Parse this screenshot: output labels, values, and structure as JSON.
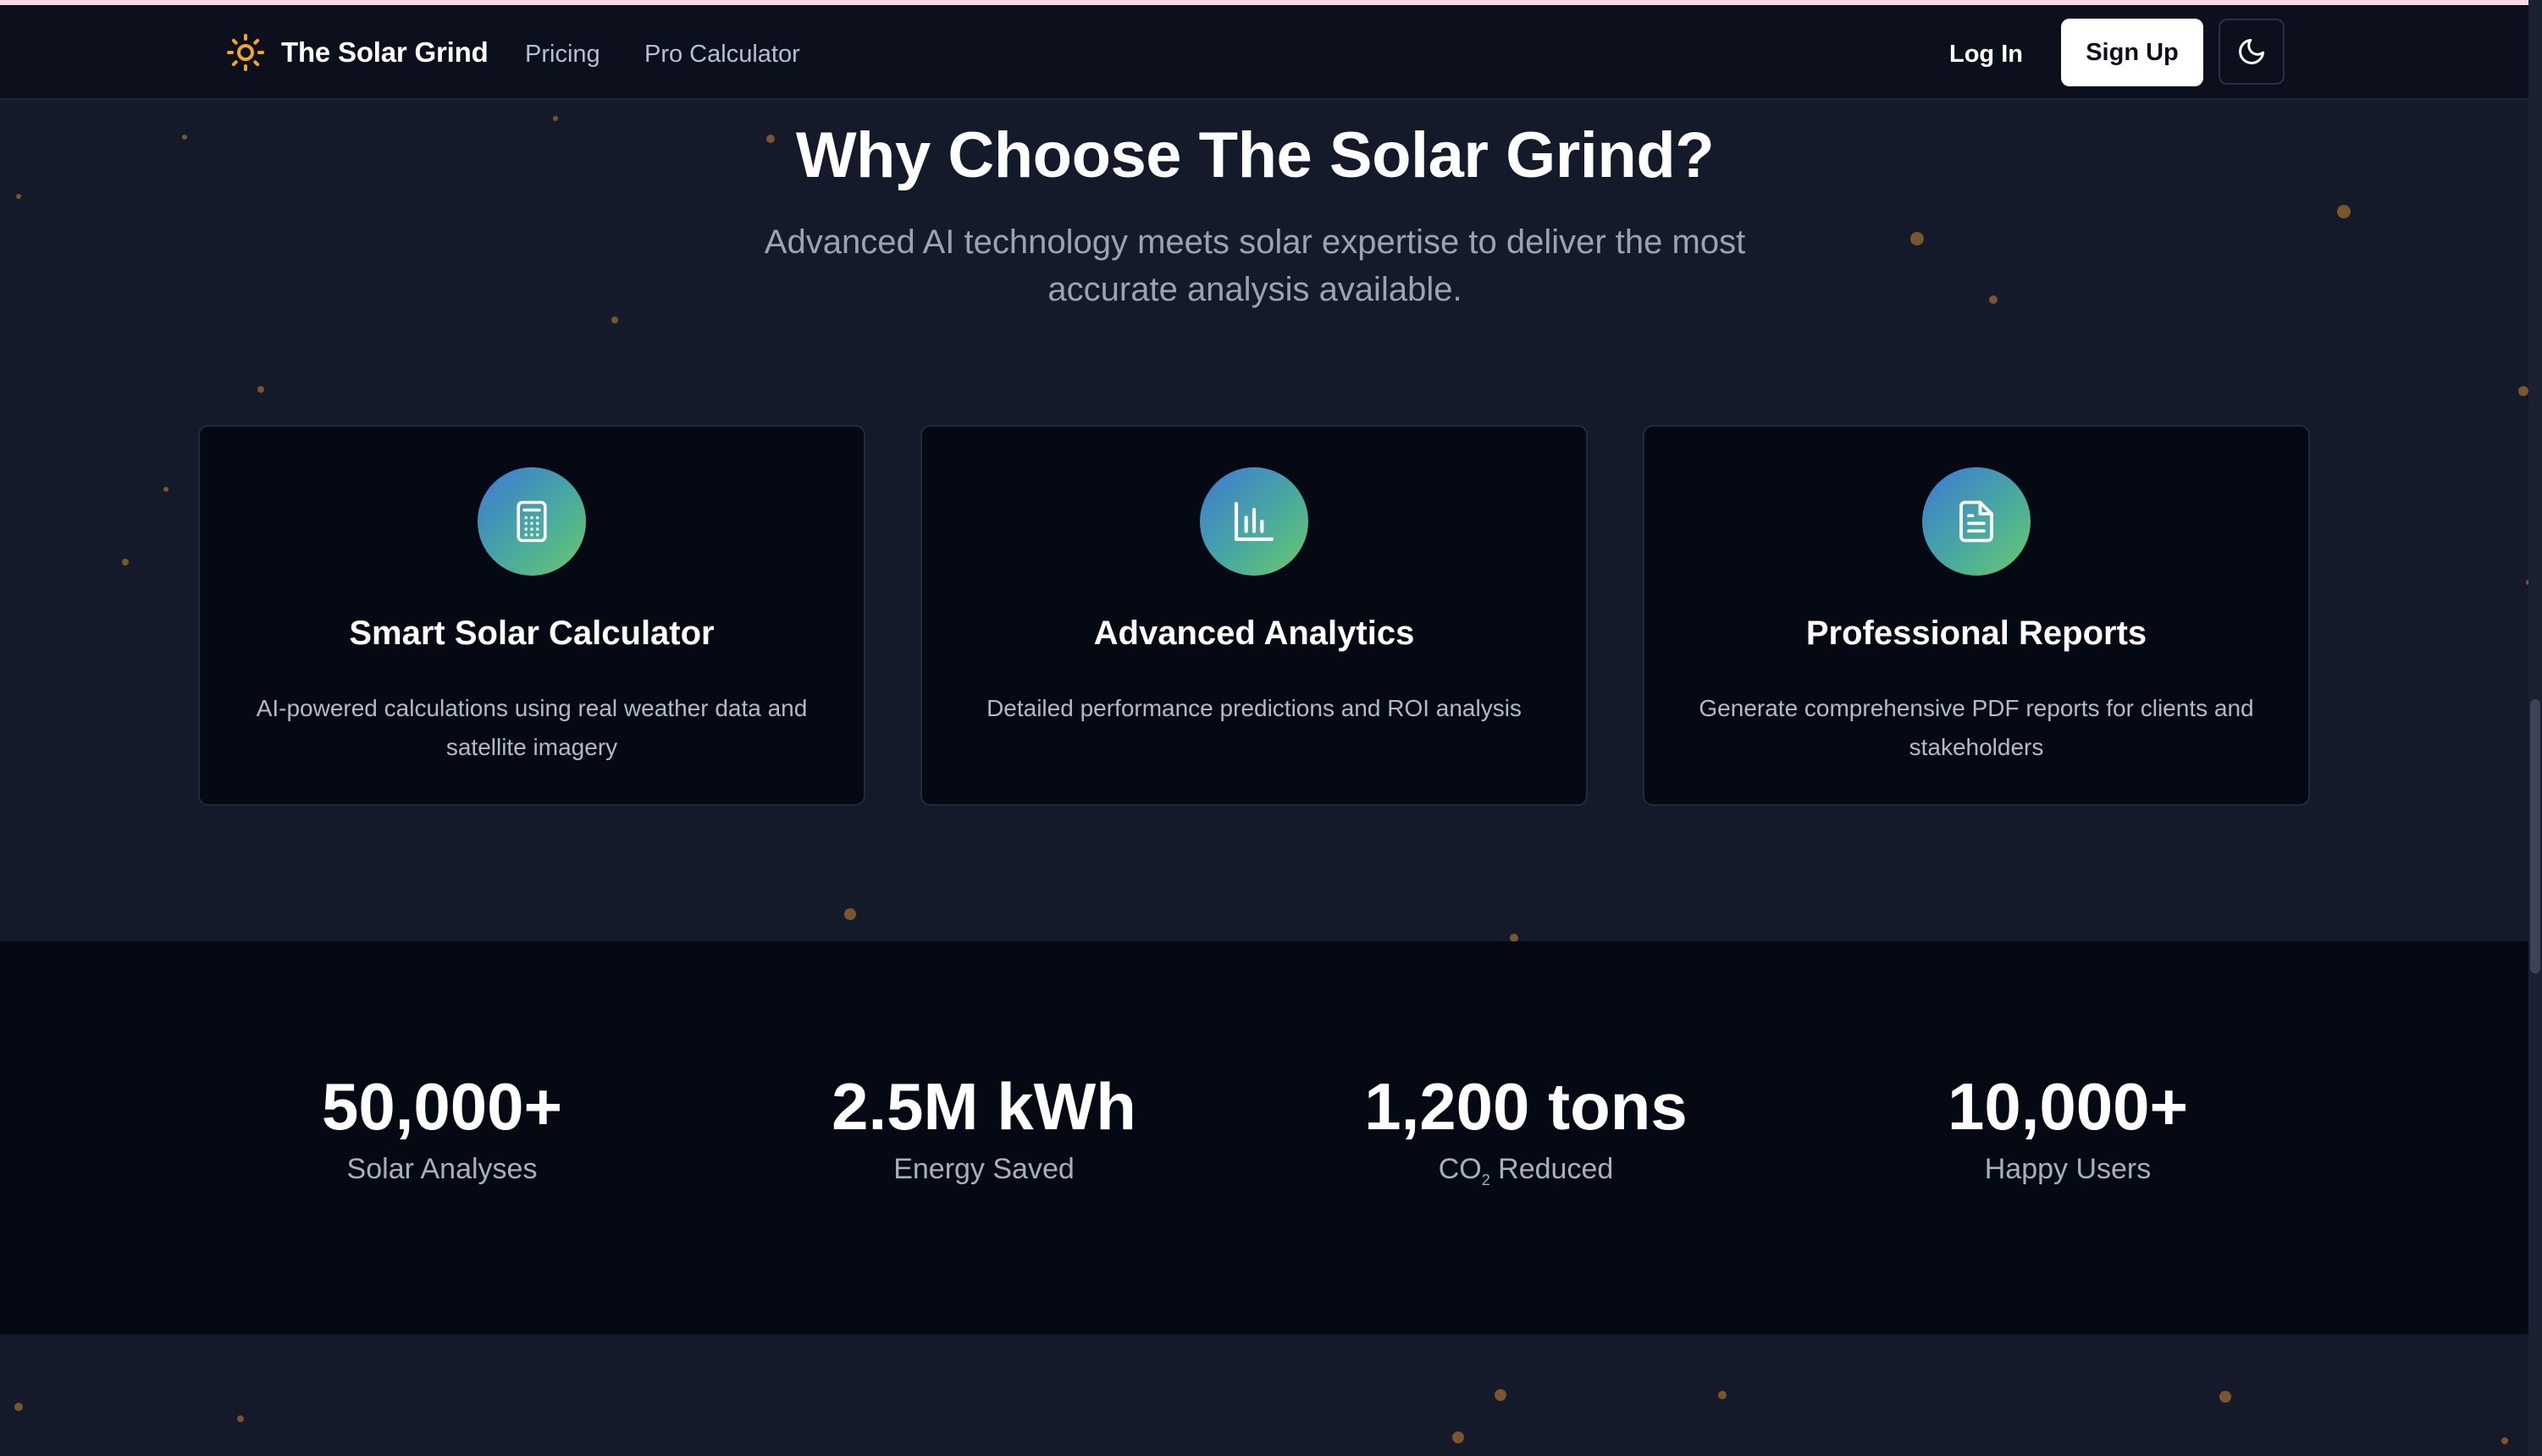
{
  "nav": {
    "brand": "The Solar Grind",
    "links": [
      "Pricing",
      "Pro Calculator"
    ],
    "login": "Log In",
    "signup": "Sign Up",
    "theme_icon": "moon-icon"
  },
  "features": {
    "title": "Why Choose The Solar Grind?",
    "subtitle": "Advanced AI technology meets solar expertise to deliver the most accurate analysis available.",
    "cards": [
      {
        "icon": "calculator-icon",
        "title": "Smart Solar Calculator",
        "description": "AI-powered calculations using real weather data and satellite imagery"
      },
      {
        "icon": "bar-chart-icon",
        "title": "Advanced Analytics",
        "description": "Detailed performance predictions and ROI analysis"
      },
      {
        "icon": "document-icon",
        "title": "Professional Reports",
        "description": "Generate comprehensive PDF reports for clients and stakeholders"
      }
    ]
  },
  "stats": [
    {
      "value": "50,000+",
      "label": "Solar Analyses"
    },
    {
      "value": "2.5M kWh",
      "label": "Energy Saved"
    },
    {
      "value": "1,200 tons",
      "label_prefix": "CO",
      "label_sub": "2",
      "label_suffix": " Reduced"
    },
    {
      "value": "10,000+",
      "label": "Happy Users"
    }
  ],
  "colors": {
    "background": "#141a29",
    "navbar": "#0b101c",
    "card": "#050914",
    "accent_gradient_start": "#3d78d6",
    "accent_gradient_end": "#6bc96c",
    "star": "#c98a2e"
  }
}
